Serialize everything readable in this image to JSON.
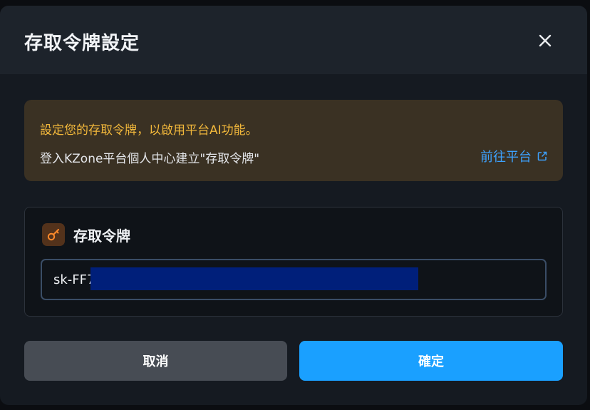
{
  "dialog": {
    "title": "存取令牌設定",
    "close_icon": "close-icon"
  },
  "notice": {
    "line1": "設定您的存取令牌，以啟用平台AI功能。",
    "line2": "登入KZone平台個人中心建立\"存取令牌\"",
    "link_label": "前往平台",
    "link_icon": "external-link-icon",
    "text_color": "#f2b83b",
    "link_color": "#3da2ff"
  },
  "token": {
    "icon": "key-icon",
    "label": "存取令牌",
    "value": "sk-FF7                                         B7D"
  },
  "buttons": {
    "cancel_label": "取消",
    "confirm_label": "確定",
    "confirm_color": "#1aa0ff"
  }
}
